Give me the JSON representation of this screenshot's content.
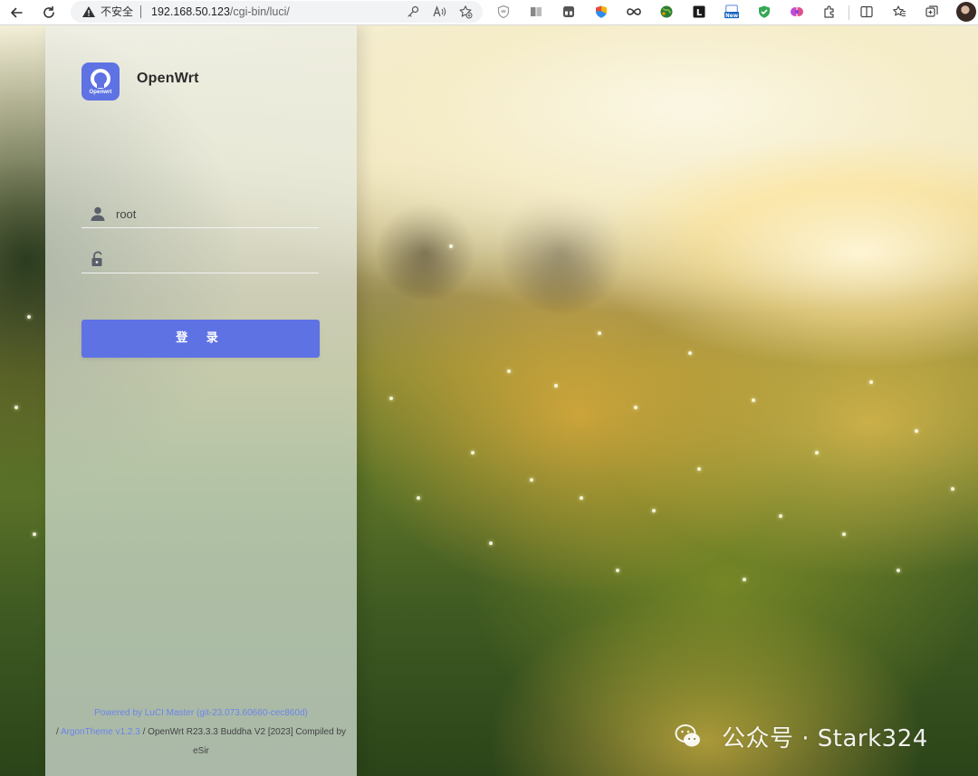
{
  "browser": {
    "security_label": "不安全",
    "url_host": "192.168.50.123",
    "url_path": "/cgi-bin/luci/",
    "extensions": [
      "shield-ext",
      "reader-ext",
      "grid-ext",
      "shield-color-ext",
      "infinity-ext",
      "globe-ext",
      "l-ext",
      "new-ext",
      "green-shield-ext",
      "brain-ext",
      "puzzle-ext"
    ],
    "new_badge": "New",
    "l_badge": "L"
  },
  "brand": {
    "name": "OpenWrt",
    "logo_text": "Openwrt",
    "accent": "#5e72e4"
  },
  "login": {
    "username_value": "root",
    "password_value": "",
    "submit_label": "登 录"
  },
  "footer": {
    "powered_link": "Powered by LuCI Master (git-23.073.60660-cec860d)",
    "slash": "/",
    "theme_link": "ArgonTheme v1.2.3",
    "compiled_text": "/ OpenWrt R23.3.3 Buddha V2 [2023] Compiled by",
    "author": "eSir"
  },
  "watermark": {
    "text": "公众号 · Stark324"
  }
}
